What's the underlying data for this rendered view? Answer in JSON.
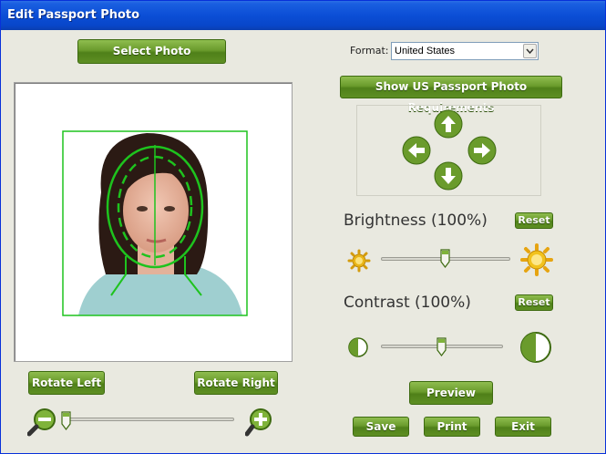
{
  "window": {
    "title": "Edit Passport Photo"
  },
  "buttons": {
    "select_photo": "Select Photo",
    "show_requirements": "Show US Passport Photo Requirements",
    "brightness_reset": "Reset",
    "contrast_reset": "Reset",
    "rotate_left": "Rotate Left",
    "rotate_right": "Rotate Right",
    "preview": "Preview",
    "save": "Save",
    "print": "Print",
    "exit": "Exit"
  },
  "format": {
    "label": "Format:",
    "value": "United States"
  },
  "brightness": {
    "label": "Brightness (100%)",
    "value_fraction": 0.5
  },
  "contrast": {
    "label": "Contrast (100%)",
    "value_fraction": 0.5
  },
  "zoom": {
    "value_fraction": 0.0
  },
  "icons": {
    "nav": [
      "arrow-up-icon",
      "arrow-left-icon",
      "arrow-right-icon",
      "arrow-down-icon"
    ],
    "brightness": [
      "sun-small-icon",
      "sun-large-icon"
    ],
    "contrast": [
      "contrast-small-icon",
      "contrast-large-icon"
    ],
    "zoom": [
      "zoom-out-icon",
      "zoom-in-icon"
    ]
  },
  "colors": {
    "accent_green": "#5e8f23",
    "guide_green": "#1ec31e",
    "title_blue": "#0b4ed6"
  }
}
